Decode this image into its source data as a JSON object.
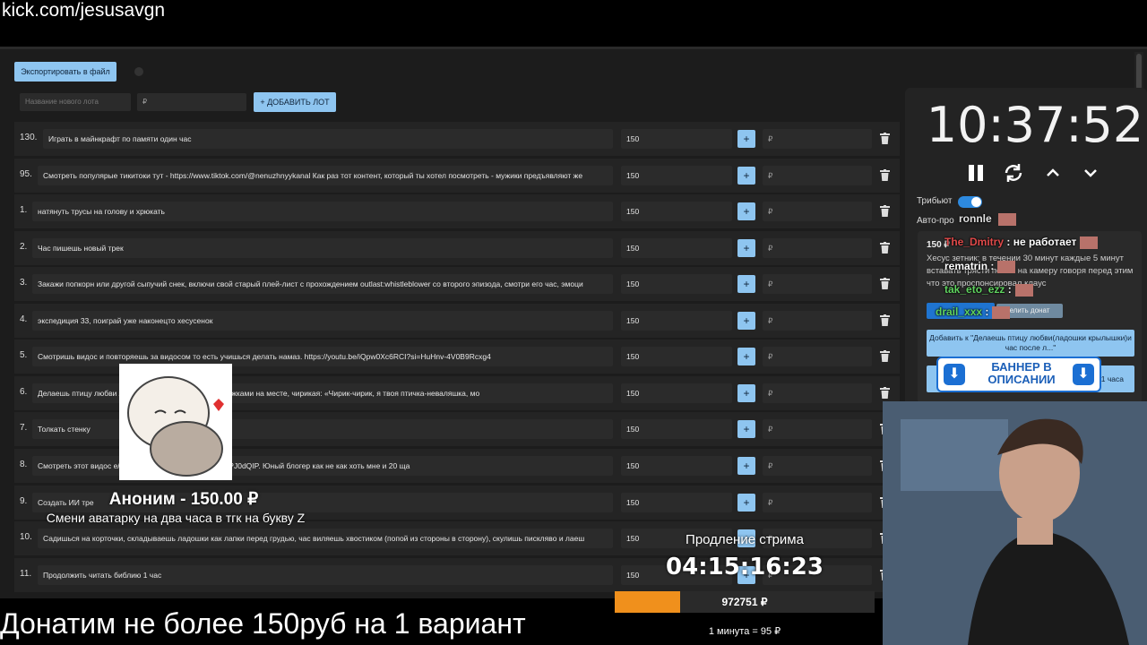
{
  "overlay": {
    "url": "kick.com/jesusavgn",
    "bottom_banner": "Донатим не более 150руб на 1 вариант"
  },
  "toolbar": {
    "export_label": "Экспортировать в файл",
    "new_lot_placeholder": "Название нового лота",
    "new_lot_price_placeholder": "₽",
    "add_lot_label": "+ ДОБАВИТЬ ЛОТ"
  },
  "lots": [
    {
      "num": "130.",
      "title": "Играть в майнкрафт по памяти один час",
      "amount": "150",
      "plus": "+",
      "rub": "₽"
    },
    {
      "num": "95.",
      "title": "Смотреть популярые тикитоки тут - https://www.tiktok.com/@nenuzhnyykanal Как раз тот контент, который ты хотел посмотреть - мужики предъявляют же",
      "amount": "150",
      "plus": "+",
      "rub": "₽"
    },
    {
      "num": "1.",
      "title": "натянуть трусы на голову и хрюкать",
      "amount": "150",
      "plus": "+",
      "rub": "₽"
    },
    {
      "num": "2.",
      "title": "Час пишешь новый трек",
      "amount": "150",
      "plus": "+",
      "rub": "₽"
    },
    {
      "num": "3.",
      "title": "Закажи попкорн или другой сыпучий снек, включи свой старый плей-лист с прохождением outlast:whistleblower со второго эпизода, смотри его час, эмоци",
      "amount": "150",
      "plus": "+",
      "rub": "₽"
    },
    {
      "num": "4.",
      "title": "экспедиция 33, поиграй уже наконецто хесусенок",
      "amount": "150",
      "plus": "+",
      "rub": "₽"
    },
    {
      "num": "5.",
      "title": "Смотришь видос и повторяешь за видосом то есть учишься делать намаз. https://youtu.be/iQpw0Xc6RCI?si=HuHnv-4V0B9Rcxg4",
      "amount": "150",
      "plus": "+",
      "rub": "₽"
    },
    {
      "num": "6.",
      "title": "Делаешь птицу любви                              ле летаешь перед камерой прыжками на месте, чирикая: «Чирик-чирик, я твоя птичка-неваляшка, мо",
      "amount": "150",
      "plus": "+",
      "rub": "₽"
    },
    {
      "num": "7.",
      "title": "Толкать стенку",
      "amount": "150",
      "plus": "+",
      "rub": "₽"
    },
    {
      "num": "8.",
      "title": "Смотреть этот видос                              e/QTWKR2GLKn4?si=vb34BMZxIPJ0dQIP. Юный блогер как не как хоть мне и 20 ща",
      "amount": "150",
      "plus": "+",
      "rub": "₽"
    },
    {
      "num": "9.",
      "title": "Создать ИИ тре",
      "amount": "150",
      "plus": "+",
      "rub": "₽"
    },
    {
      "num": "10.",
      "title": "Садишься на корточки, складываешь ладошки как лапки перед грудью, час виляешь хвостиком (попой из стороны в сторону), скулишь писклявo и лаеш",
      "amount": "150",
      "plus": "+",
      "rub": "₽"
    },
    {
      "num": "11.",
      "title": "Продолжить читать библию 1 час",
      "amount": "150",
      "plus": "+",
      "rub": "₽"
    }
  ],
  "timer": {
    "time": "10:37:52",
    "tribute_label": "Трибьют",
    "auto_label": "Авто-про"
  },
  "donation": {
    "price": "150 ₽",
    "text": "Хесус зетник: в течении 30 минут каждые 5 минут вставать трясти попой на камеру говоря перед этим что это проспонсировал клаус",
    "action_label": "елить донат",
    "add_to_label": "Добавить к \"Делаешь птицу любви(ладошки крылышки)и час после л...\"",
    "hours_label": "1 часа"
  },
  "banner": {
    "text": "БАННЕР В ОПИСАНИИ"
  },
  "chat": [
    {
      "user": "ronnle",
      "color": "#e0e0e0",
      "message": ""
    },
    {
      "user": "The_Dmitry",
      "color": "#e04a4a",
      "message": ": не работает"
    },
    {
      "user": "rematrin",
      "color": "#ffffff",
      "message": ":"
    },
    {
      "user": "tak_eto_ezz",
      "color": "#5fd35f",
      "message": ":"
    },
    {
      "user": "drail_xxx",
      "color": "#5fd35f",
      "message": ":"
    }
  ],
  "alert": {
    "title": "Аноним - 150.00 ₽",
    "message": "Смени аватарку на два часа в тгк на букву Z"
  },
  "extension": {
    "label": "Продление стрима",
    "time": "04:15:16:23",
    "total": "972751 ₽",
    "progress": 0.25,
    "rate": "1 минута = 95 ₽"
  },
  "colors": {
    "accent": "#8ec5f0",
    "progress": "#f0901c",
    "toggle": "#2d8ae0"
  }
}
